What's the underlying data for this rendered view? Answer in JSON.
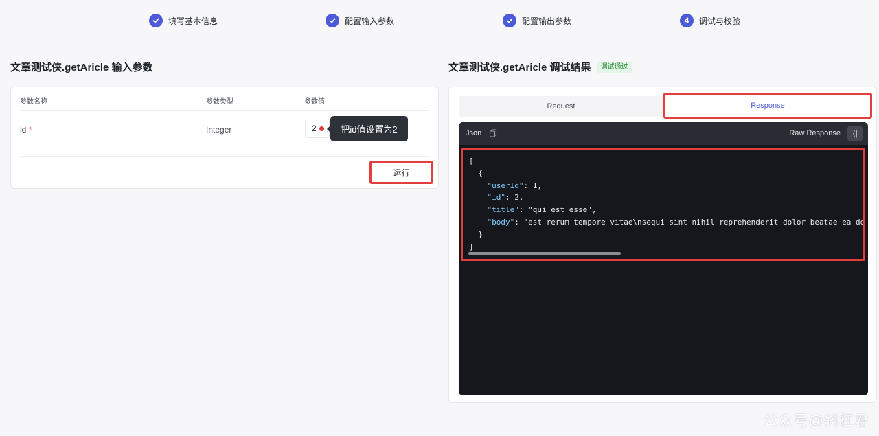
{
  "stepper": {
    "steps": [
      {
        "label": "填写基本信息",
        "state": "done"
      },
      {
        "label": "配置输入参数",
        "state": "done"
      },
      {
        "label": "配置输出参数",
        "state": "done"
      },
      {
        "label": "调试与校验",
        "number": "4",
        "state": "active"
      }
    ]
  },
  "input_panel": {
    "title": "文章测试侠.getAricle 输入参数",
    "columns": [
      "参数名称",
      "参数类型",
      "参数值"
    ],
    "rows": [
      {
        "name": "id",
        "required_mark": "*",
        "type": "Integer",
        "value": "2"
      }
    ],
    "tooltip": "把id值设置为2",
    "run_label": "运行"
  },
  "result_panel": {
    "title": "文章测试侠.getAricle 调试结果",
    "status_badge": "调试通过",
    "tabs": [
      "Request",
      "Response"
    ],
    "active_tab": "Response",
    "code_lang": "Json",
    "raw_label": "Raw Response",
    "collapse_glyph": "⟨|",
    "code_lines": [
      "[",
      "  {",
      "    \"userId\": 1,",
      "    \"id\": 2,",
      "    \"title\": \"qui est esse\",",
      "    \"body\": \"est rerum tempore vitae\\nsequi sint nihil reprehenderit dolor beatae ea do",
      "  }",
      "]"
    ]
  },
  "colors": {
    "accent": "#4e5bd8",
    "highlight_border": "#e23e3e",
    "code_bg": "#16161d",
    "success": "#2b8a3e"
  },
  "watermark": "公众号@斜杠君"
}
